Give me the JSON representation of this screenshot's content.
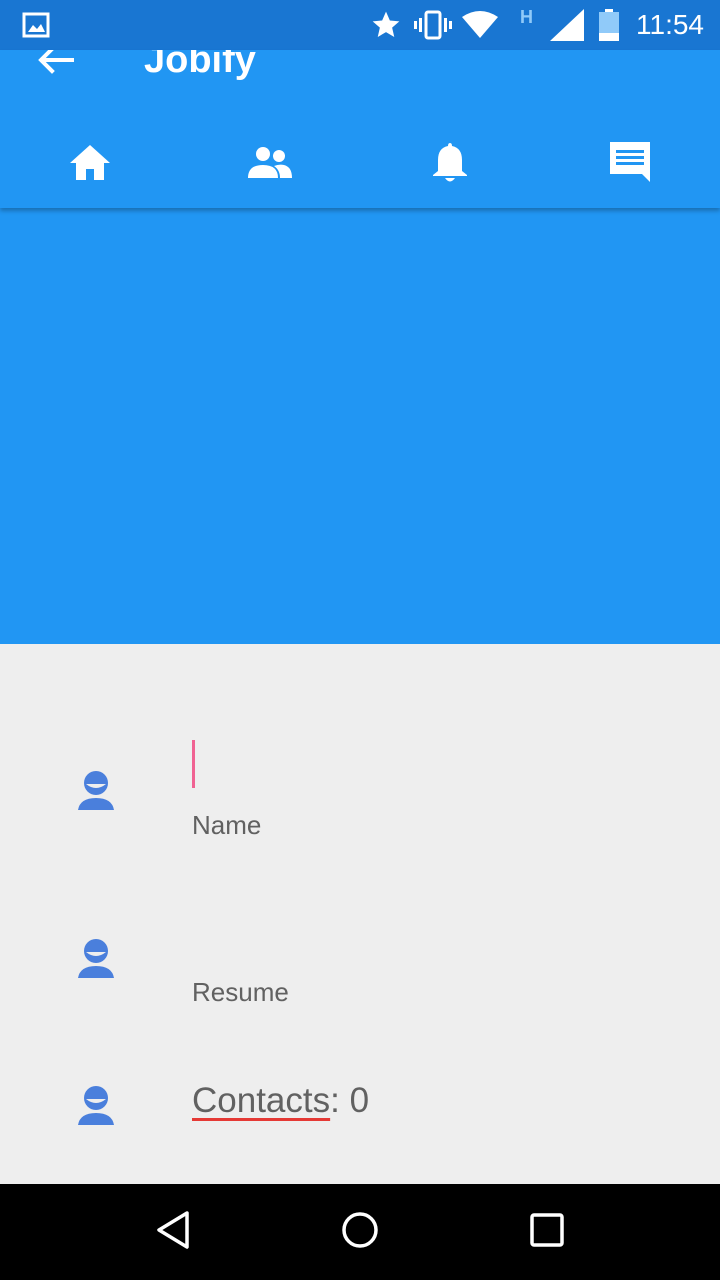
{
  "colors": {
    "status_bar": "#1976d2",
    "primary": "#2196f3",
    "accent": "#f06292",
    "background": "#eeeeee",
    "icon_blue": "#4a7fdc",
    "text_secondary": "#616161"
  },
  "status_bar": {
    "time": "11:54",
    "network_label": "H",
    "icons": [
      "image-icon",
      "star-icon",
      "vibrate-icon",
      "wifi-icon",
      "signal-icon",
      "battery-icon"
    ]
  },
  "app_bar": {
    "title": "Jobify",
    "back_icon": "arrow-back-icon"
  },
  "tabs": [
    {
      "icon": "home-icon",
      "selected": true
    },
    {
      "icon": "people-icon",
      "selected": false
    },
    {
      "icon": "bell-icon",
      "selected": false
    },
    {
      "icon": "chat-icon",
      "selected": false
    }
  ],
  "form": {
    "name_label": "Name",
    "resume_label": "Resume",
    "contacts_label": "Contacts",
    "contacts_separator": ": ",
    "contacts_count": "0"
  },
  "nav_bar": {
    "buttons": [
      "back-triangle-icon",
      "home-circle-icon",
      "recents-square-icon"
    ]
  }
}
